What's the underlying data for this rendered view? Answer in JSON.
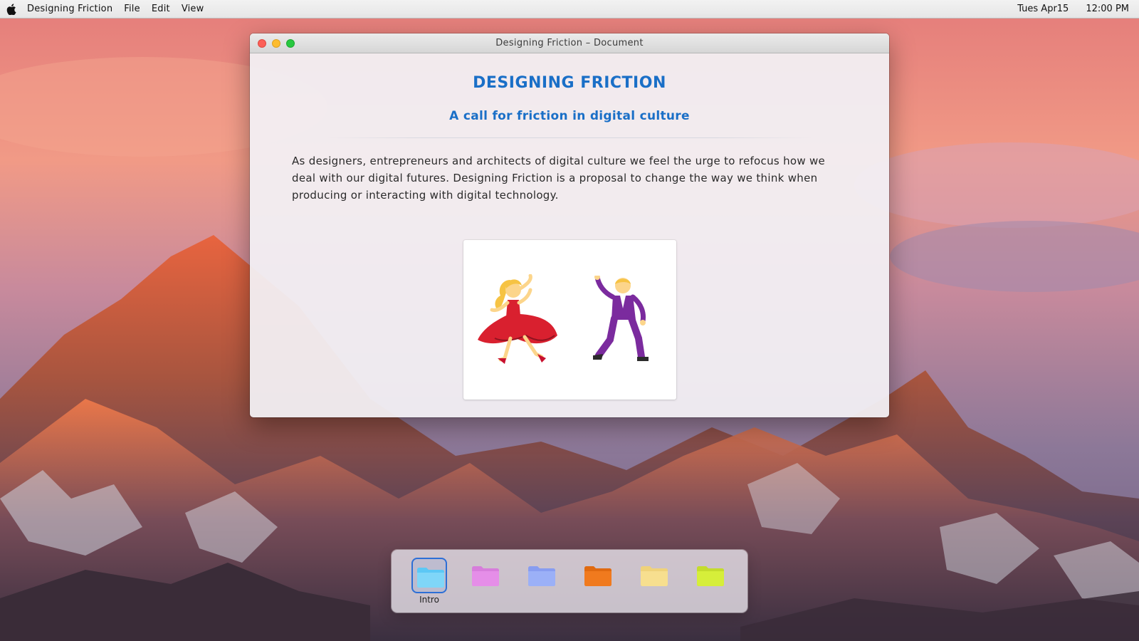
{
  "menubar": {
    "app_name": "Designing Friction",
    "menus": [
      "File",
      "Edit",
      "View"
    ],
    "date": "Tues Apr15",
    "time": "12:00 PM"
  },
  "window": {
    "title": "Designing Friction – Document"
  },
  "document": {
    "title": "DESIGNING FRICTION",
    "subtitle": "A call for friction in digital culture",
    "body": "As designers, entrepreneurs and architects of digital culture we feel the urge to refocus how we deal with our digital futures. Designing Friction is a proposal to change the way we think when producing or interacting with digital technology.",
    "image_icons": [
      "woman-dancing-icon",
      "man-dancing-icon"
    ]
  },
  "dock": {
    "items": [
      {
        "label": "Intro",
        "color": "#5cc8f5",
        "active": true
      },
      {
        "label": "",
        "color": "#e58ee8",
        "active": false
      },
      {
        "label": "",
        "color": "#9bb0f7",
        "active": false
      },
      {
        "label": "",
        "color": "#f07a1e",
        "active": false
      },
      {
        "label": "",
        "color": "#f7df8f",
        "active": false
      },
      {
        "label": "",
        "color": "#d6ee3a",
        "active": false
      }
    ]
  },
  "colors": {
    "accent_blue": "#1a6fc7",
    "close": "#fc5f57",
    "minimize": "#fdbc2e",
    "maximize": "#28c840"
  }
}
